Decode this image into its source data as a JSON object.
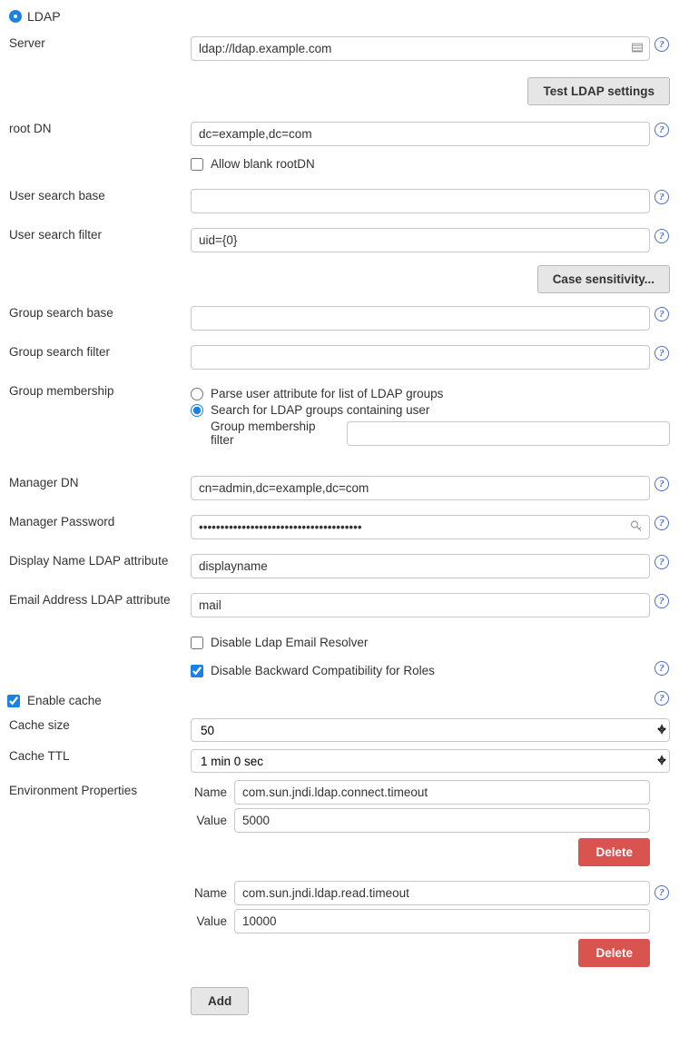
{
  "section": {
    "title": "LDAP"
  },
  "labels": {
    "server": "Server",
    "test_btn": "Test LDAP settings",
    "root_dn": "root DN",
    "allow_blank": "Allow blank rootDN",
    "user_search_base": "User search base",
    "user_search_filter": "User search filter",
    "case_btn": "Case sensitivity...",
    "group_search_base": "Group search base",
    "group_search_filter": "Group search filter",
    "group_membership": "Group membership",
    "gm_parse": "Parse user attribute for list of LDAP groups",
    "gm_search": "Search for LDAP groups containing user",
    "gm_filter": "Group membership filter",
    "manager_dn": "Manager DN",
    "manager_password": "Manager Password",
    "display_name_attr": "Display Name LDAP attribute",
    "email_attr": "Email Address LDAP attribute",
    "disable_email_resolver": "Disable Ldap Email Resolver",
    "disable_backcompat": "Disable Backward Compatibility for Roles",
    "enable_cache": "Enable cache",
    "cache_size": "Cache size",
    "cache_ttl": "Cache TTL",
    "environment_properties": "Environment Properties",
    "name": "Name",
    "value": "Value",
    "delete": "Delete",
    "add": "Add"
  },
  "values": {
    "server": "ldap://ldap.example.com",
    "root_dn": "dc=example,dc=com",
    "allow_blank": false,
    "user_search_base": "",
    "user_search_filter": "uid={0}",
    "group_search_base": "",
    "group_search_filter": "",
    "group_membership": "search",
    "group_membership_filter": "",
    "manager_dn": "cn=admin,dc=example,dc=com",
    "manager_password": "••••••••••••••••••••••••••••••••••••••",
    "display_name_attr": "displayname",
    "email_attr": "mail",
    "disable_email_resolver": false,
    "disable_backcompat": true,
    "enable_cache": true,
    "cache_size": "50",
    "cache_ttl": "1 min 0 sec",
    "env_props": [
      {
        "name": "com.sun.jndi.ldap.connect.timeout",
        "value": "5000"
      },
      {
        "name": "com.sun.jndi.ldap.read.timeout",
        "value": "10000"
      }
    ]
  }
}
